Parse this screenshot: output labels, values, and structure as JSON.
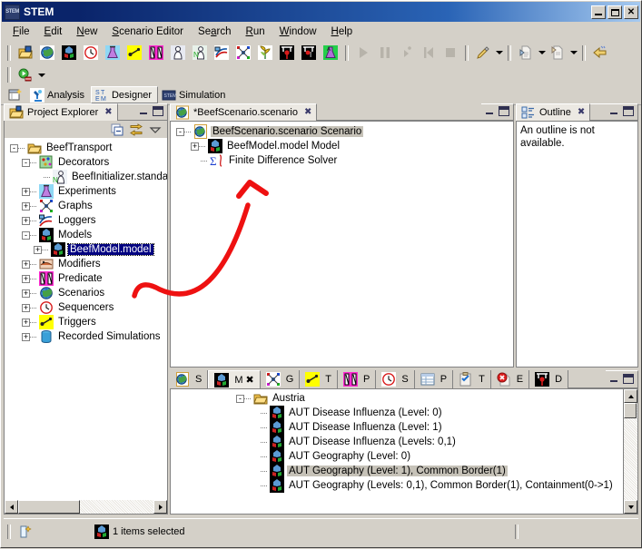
{
  "window": {
    "title": "STEM",
    "app_icon": "stem-logo-icon",
    "minimize": "_",
    "maximize": "□",
    "close": "✕"
  },
  "menubar": {
    "items": [
      {
        "label": "File",
        "mnemonic": "F"
      },
      {
        "label": "Edit",
        "mnemonic": "E"
      },
      {
        "label": "New",
        "mnemonic": "N"
      },
      {
        "label": "Scenario Editor",
        "mnemonic": "S"
      },
      {
        "label": "Search",
        "mnemonic": "a"
      },
      {
        "label": "Run",
        "mnemonic": "R"
      },
      {
        "label": "Window",
        "mnemonic": "W"
      },
      {
        "label": "Help",
        "mnemonic": "H"
      }
    ]
  },
  "toolbar": {
    "row1": [
      {
        "name": "open-project-icon",
        "tip": "Open Project"
      },
      {
        "name": "new-scenario-globe-icon",
        "tip": "New Scenario"
      },
      {
        "name": "new-model-icon",
        "tip": "New Model"
      },
      {
        "name": "new-sequencer-clock-icon",
        "tip": "New Sequencer"
      },
      {
        "name": "new-experiment-flask-icon",
        "tip": "New Experiment"
      },
      {
        "name": "new-trigger-icon",
        "tip": "New Trigger"
      },
      {
        "name": "new-predicate-icon",
        "tip": "New Predicate"
      },
      {
        "name": "new-population-icon",
        "tip": "New Population"
      },
      {
        "name": "new-population-initializer-icon",
        "tip": "New Population Initializer"
      },
      {
        "name": "new-logger-icon",
        "tip": "New Logger"
      },
      {
        "name": "new-graph-icon",
        "tip": "New Graph"
      },
      {
        "name": "new-food-production-icon",
        "tip": "New Food Production"
      },
      {
        "name": "new-disease-icon",
        "tip": "New Disease"
      },
      {
        "name": "new-disease-2-icon",
        "tip": "New Disease"
      },
      {
        "name": "new-automatic-experiment-icon",
        "tip": "New Automatic Experiment"
      }
    ],
    "row1_right": [
      {
        "name": "run-icon",
        "tip": "Run",
        "disabled": true
      },
      {
        "name": "pause-icon",
        "tip": "Pause",
        "disabled": true
      },
      {
        "name": "step-icon",
        "tip": "Step",
        "disabled": true
      },
      {
        "name": "reset-icon",
        "tip": "Reset",
        "disabled": true
      },
      {
        "name": "stop-icon",
        "tip": "Stop",
        "disabled": true
      },
      {
        "name": "edit-pencil-icon",
        "tip": "Edit"
      },
      {
        "name": "import-icon",
        "tip": "Import"
      },
      {
        "name": "export-icon",
        "tip": "Export"
      },
      {
        "name": "back-arrow-icon",
        "tip": "Back"
      }
    ],
    "row2": [
      {
        "name": "run-simulation-icon",
        "tip": "Run Simulation"
      }
    ]
  },
  "perspectives": {
    "open_perspective_icon": "open-perspective-icon",
    "tabs": [
      {
        "label": "Analysis",
        "icon": "analysis-microscope-icon",
        "active": false
      },
      {
        "label": "Designer",
        "icon": "stem-designer-icon",
        "active": true
      },
      {
        "label": "Simulation",
        "icon": "stem-simulation-icon",
        "active": false
      }
    ]
  },
  "project_explorer": {
    "tab_label": "Project Explorer",
    "tab_icon": "project-explorer-icon",
    "close_label": "✕",
    "local_toolbar": [
      {
        "name": "collapse-all-icon"
      },
      {
        "name": "link-with-editor-icon"
      },
      {
        "name": "view-menu-icon"
      }
    ],
    "tree": [
      {
        "label": "BeefTransport",
        "icon": "project-folder-icon",
        "indent": 0,
        "expander": "-",
        "selected": false
      },
      {
        "label": "Decorators",
        "icon": "decorators-icon",
        "indent": 1,
        "expander": "-",
        "selected": false
      },
      {
        "label": "BeefInitializer.standardinitializer",
        "icon": "initializer-icon",
        "indent": 2,
        "expander": "",
        "selected": false
      },
      {
        "label": "Experiments",
        "icon": "experiments-flask-icon",
        "indent": 1,
        "expander": "+",
        "selected": false
      },
      {
        "label": "Graphs",
        "icon": "graphs-icon",
        "indent": 1,
        "expander": "+",
        "selected": false
      },
      {
        "label": "Loggers",
        "icon": "loggers-icon",
        "indent": 1,
        "expander": "+",
        "selected": false
      },
      {
        "label": "Models",
        "icon": "models-icon",
        "indent": 1,
        "expander": "-",
        "selected": false
      },
      {
        "label": "BeefModel.model",
        "icon": "model-icon",
        "indent": 2,
        "expander": "+",
        "selected": true
      },
      {
        "label": "Modifiers",
        "icon": "modifiers-icon",
        "indent": 1,
        "expander": "+",
        "selected": false
      },
      {
        "label": "Predicate",
        "icon": "predicate-icon",
        "indent": 1,
        "expander": "+",
        "selected": false
      },
      {
        "label": "Scenarios",
        "icon": "scenarios-globe-icon",
        "indent": 1,
        "expander": "+",
        "selected": false
      },
      {
        "label": "Sequencers",
        "icon": "sequencers-clock-icon",
        "indent": 1,
        "expander": "+",
        "selected": false
      },
      {
        "label": "Triggers",
        "icon": "triggers-icon",
        "indent": 1,
        "expander": "+",
        "selected": false
      },
      {
        "label": "Recorded Simulations",
        "icon": "recorded-simulations-icon",
        "indent": 1,
        "expander": "+",
        "selected": false
      }
    ]
  },
  "editor": {
    "tab_label": "*BeefScenario.scenario",
    "tab_icon": "scenario-globe-icon",
    "close_label": "✕",
    "dirty": true,
    "tree": [
      {
        "label": "BeefScenario.scenario Scenario",
        "icon": "scenario-globe-icon",
        "indent": 0,
        "expander": "-",
        "selected": true
      },
      {
        "label": "BeefModel.model Model",
        "icon": "model-icon",
        "indent": 1,
        "expander": "+",
        "selected": false
      },
      {
        "label": "Finite Difference Solver",
        "icon": "solver-sigma-icon",
        "indent": 1,
        "expander": "",
        "selected": false
      }
    ]
  },
  "outline": {
    "tab_label": "Outline",
    "tab_icon": "outline-icon",
    "close_label": "✕",
    "message": "An outline is not available."
  },
  "bottom_panel": {
    "tabs": [
      {
        "label": "S",
        "full": "Scenarios",
        "icon": "scenario-globe-icon",
        "active": false
      },
      {
        "label": "M",
        "full": "Models",
        "icon": "models-icon",
        "active": true
      },
      {
        "label": "G",
        "full": "Graphs",
        "icon": "graphs-icon",
        "active": false
      },
      {
        "label": "T",
        "full": "Triggers",
        "icon": "triggers-icon",
        "active": false
      },
      {
        "label": "P",
        "full": "Predicates",
        "icon": "predicate-icon",
        "active": false
      },
      {
        "label": "S",
        "full": "Sequencers",
        "icon": "sequencers-clock-icon",
        "active": false
      },
      {
        "label": "P",
        "full": "Properties",
        "icon": "properties-icon",
        "active": false
      },
      {
        "label": "T",
        "full": "Tasks",
        "icon": "tasks-icon",
        "active": false
      },
      {
        "label": "E",
        "full": "Error Log",
        "icon": "error-log-icon",
        "active": false
      },
      {
        "label": "D",
        "full": "Diseases",
        "icon": "disease-icon",
        "active": false
      }
    ],
    "close_label": "✕",
    "list": [
      {
        "label": "Austria",
        "icon": "folder-open-icon",
        "indent": 0,
        "expander": "-",
        "selected": false
      },
      {
        "label": "AUT Disease Influenza (Level: 0)",
        "icon": "model-icon",
        "indent": 1,
        "expander": "",
        "selected": false
      },
      {
        "label": "AUT Disease Influenza (Level: 1)",
        "icon": "model-icon",
        "indent": 1,
        "expander": "",
        "selected": false
      },
      {
        "label": "AUT Disease Influenza (Levels: 0,1)",
        "icon": "model-icon",
        "indent": 1,
        "expander": "",
        "selected": false
      },
      {
        "label": "AUT Geography (Level: 0)",
        "icon": "model-icon",
        "indent": 1,
        "expander": "",
        "selected": false
      },
      {
        "label": "AUT Geography (Level: 1), Common Border(1)",
        "icon": "model-icon",
        "indent": 1,
        "expander": "",
        "selected": true
      },
      {
        "label": "AUT Geography (Levels: 0,1), Common Border(1), Containment(0->1)",
        "icon": "model-icon",
        "indent": 1,
        "expander": "",
        "selected": false
      }
    ]
  },
  "statusbar": {
    "selection_icon": "selection-indicator-icon",
    "item_icon": "model-icon",
    "message": "1 items selected"
  },
  "annotation": {
    "type": "red-curved-arrow",
    "color": "#ee1111",
    "from": "BeefModel.model in Project Explorer",
    "to": "BeefModel.model Model in scenario editor"
  }
}
